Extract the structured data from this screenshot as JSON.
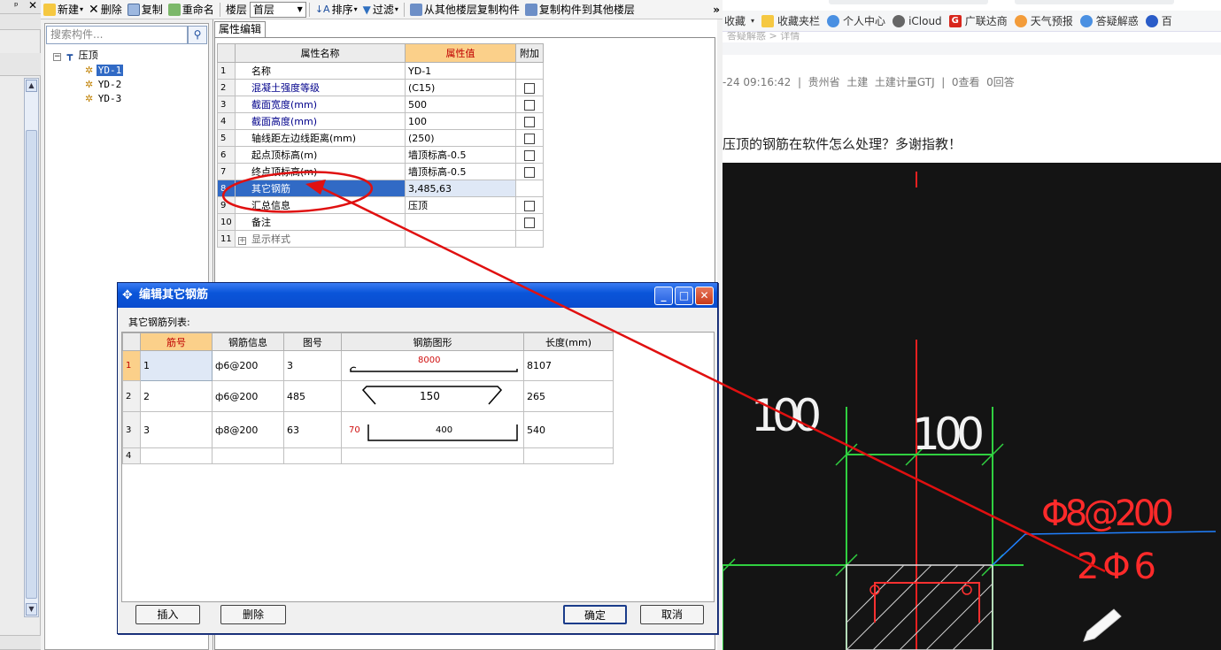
{
  "toolbar": {
    "items": [
      "新建",
      "删除",
      "复制",
      "重命名",
      "楼层",
      "排序",
      "过滤",
      "从其他楼层复制构件",
      "复制构件到其他楼层"
    ],
    "floor_value": "首层",
    "more": "»"
  },
  "tree": {
    "search_placeholder": "搜索构件...",
    "root": "压顶",
    "items": [
      "YD-1",
      "YD-2",
      "YD-3"
    ],
    "selected": "YD-1"
  },
  "props": {
    "tab": "属性编辑",
    "headers": [
      "属性名称",
      "属性值",
      "附加"
    ],
    "rows": [
      {
        "n": "1",
        "name": "名称",
        "value": "YD-1",
        "check": false
      },
      {
        "n": "2",
        "name": "混凝土强度等级",
        "value": "(C15)",
        "check": true
      },
      {
        "n": "3",
        "name": "截面宽度(mm)",
        "value": "500",
        "check": true
      },
      {
        "n": "4",
        "name": "截面高度(mm)",
        "value": "100",
        "check": true
      },
      {
        "n": "5",
        "name": "轴线距左边线距离(mm)",
        "value": "(250)",
        "check": true
      },
      {
        "n": "6",
        "name": "起点顶标高(m)",
        "value": "墙顶标高-0.5",
        "check": true
      },
      {
        "n": "7",
        "name": "终点顶标高(m)",
        "value": "墙顶标高-0.5",
        "check": true
      },
      {
        "n": "8",
        "name": "其它钢筋",
        "value": "3,485,63",
        "check": false
      },
      {
        "n": "9",
        "name": "汇总信息",
        "value": "压顶",
        "check": true
      },
      {
        "n": "10",
        "name": "备注",
        "value": "",
        "check": true
      },
      {
        "n": "11",
        "name": "显示样式",
        "value": "",
        "check": false
      }
    ]
  },
  "dialog": {
    "title": "编辑其它钢筋",
    "list_label": "其它钢筋列表:",
    "headers": [
      "筋号",
      "钢筋信息",
      "图号",
      "钢筋图形",
      "长度(mm)"
    ],
    "rows": [
      {
        "n": "1",
        "id": "1",
        "info": "ф6@200",
        "fig": "3",
        "shape_label": "8000",
        "shape_side": "",
        "length": "8107"
      },
      {
        "n": "2",
        "id": "2",
        "info": "ф6@200",
        "fig": "485",
        "shape_label": "150",
        "shape_side": "",
        "length": "265"
      },
      {
        "n": "3",
        "id": "3",
        "info": "ф8@200",
        "fig": "63",
        "shape_label": "400",
        "shape_side": "70",
        "length": "540"
      },
      {
        "n": "4",
        "id": "",
        "info": "",
        "fig": "",
        "shape_label": "",
        "shape_side": "",
        "length": ""
      }
    ],
    "buttons": {
      "insert": "插入",
      "delete": "删除",
      "ok": "确定",
      "cancel": "取消"
    }
  },
  "browser": {
    "bookmarks": [
      "收藏",
      "收藏夹栏",
      "个人中心",
      "iCloud",
      "广联达商",
      "天气预报",
      "答疑解惑",
      "百"
    ],
    "breadcrumb": "答疑解惑 > 详情",
    "meta": "-24 09:16:42  |  贵州省  土建  土建计量GTJ  |  0查看  0回答",
    "question": "压顶的钢筋在软件怎么处理？多谢指教！",
    "photo_texts": {
      "dim_left": "100",
      "dim_right": "100",
      "rebar1": "Φ8@200",
      "rebar2": "2Φ6"
    }
  },
  "colors": {
    "accent_red": "#e01010",
    "title_blue": "#0a55d9",
    "selection": "#316ac5",
    "header_orange": "#fbd08a"
  }
}
